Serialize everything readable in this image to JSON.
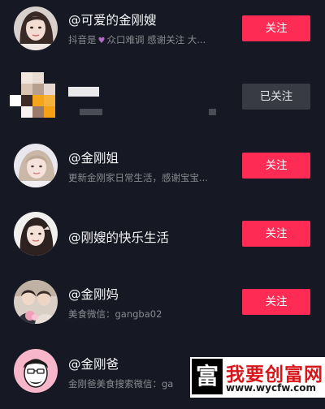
{
  "users": [
    {
      "name": "@可爱的金刚嫂",
      "bio_prefix": "抖音是",
      "bio_heart": "♥",
      "bio_suffix": "众口难调 感谢关注 大...",
      "button": "关注",
      "followed": false
    },
    {
      "name": "",
      "bio": "",
      "button": "已关注",
      "followed": true
    },
    {
      "name": "@金刚姐",
      "bio": "更新金刚家日常生活，感谢宝宝...",
      "button": "关注",
      "followed": false
    },
    {
      "name": "@刚嫂的快乐生活",
      "bio": "",
      "button": "关注",
      "followed": false
    },
    {
      "name": "@金刚妈",
      "bio": "美食微信：gangba02",
      "button": "关注",
      "followed": false
    },
    {
      "name": "@金刚爸",
      "bio": "金刚爸美食搜索微信：ga",
      "button": "",
      "followed": false
    }
  ],
  "watermark": {
    "logo_char": "富",
    "title": "我要创富网",
    "url": "www.wycfw.com"
  },
  "colors": {
    "background": "#161823",
    "follow_button": "#fe2c55",
    "followed_button": "#393b44"
  }
}
